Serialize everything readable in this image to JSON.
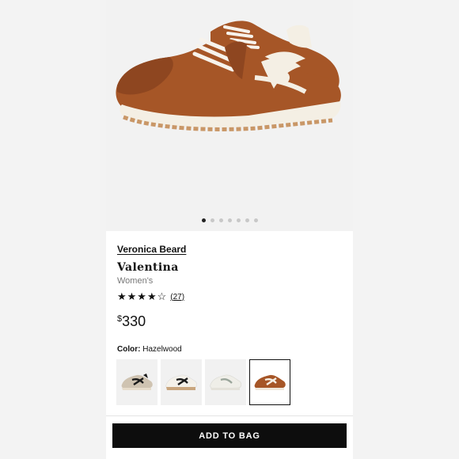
{
  "gallery": {
    "image": "hazelwood-suede-sneakers",
    "slides_total": 7,
    "active_slide": 1
  },
  "product": {
    "brand": "Veronica Beard",
    "name": "Valentina",
    "gender": "Women's",
    "rating": 4,
    "rating_max": 5,
    "stars_display": "★★★★☆",
    "review_count": "(27)",
    "price_currency": "$",
    "price_value": "330"
  },
  "color": {
    "label": "Color:",
    "selected": "Hazelwood",
    "swatches": [
      {
        "name": "taupe-black",
        "upper": "#cfc3b1",
        "accent": "#1a1a1a",
        "sole": "#e7dccb"
      },
      {
        "name": "white-black-tan",
        "upper": "#f4f1ea",
        "accent": "#1a1a1a",
        "sole": "#c9a67e"
      },
      {
        "name": "white-sage",
        "upper": "#efeee8",
        "accent": "#9aa59a",
        "sole": "#e4e2da"
      },
      {
        "name": "hazelwood",
        "upper": "#a65627",
        "accent": "#f6f0e6",
        "sole": "#efe7da"
      }
    ]
  },
  "actions": {
    "add_to_bag": "ADD TO BAG"
  },
  "colors": {
    "suede": "#a65627",
    "suede_dark": "#7d3e18",
    "cream": "#f4efe4",
    "gum": "#c99767",
    "button": "#0d0d0d"
  }
}
